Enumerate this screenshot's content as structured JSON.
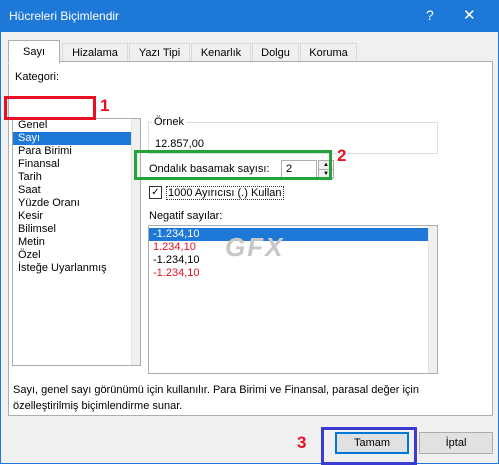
{
  "window": {
    "title": "Hücreleri Biçimlendir",
    "help_glyph": "?",
    "close_glyph": "✕"
  },
  "tabs": [
    {
      "label": "Sayı",
      "active": true
    },
    {
      "label": "Hizalama",
      "active": false
    },
    {
      "label": "Yazı Tipi",
      "active": false
    },
    {
      "label": "Kenarlık",
      "active": false
    },
    {
      "label": "Dolgu",
      "active": false
    },
    {
      "label": "Koruma",
      "active": false
    }
  ],
  "category": {
    "label": "Kategori:",
    "items": [
      {
        "label": "Genel",
        "selected": false
      },
      {
        "label": "Sayı",
        "selected": true
      },
      {
        "label": "Para Birimi",
        "selected": false
      },
      {
        "label": "Finansal",
        "selected": false
      },
      {
        "label": "Tarih",
        "selected": false
      },
      {
        "label": "Saat",
        "selected": false
      },
      {
        "label": "Yüzde Oranı",
        "selected": false
      },
      {
        "label": "Kesir",
        "selected": false
      },
      {
        "label": "Bilimsel",
        "selected": false
      },
      {
        "label": "Metin",
        "selected": false
      },
      {
        "label": "Özel",
        "selected": false
      },
      {
        "label": "İsteğe Uyarlanmış",
        "selected": false
      }
    ]
  },
  "sample": {
    "label": "Örnek",
    "value": "12.857,00"
  },
  "decimal": {
    "label": "Ondalık basamak sayısı:",
    "value": "2"
  },
  "separator": {
    "label": "1000 Ayırıcısı (.) Kullan",
    "checked": true,
    "check_glyph": "✓"
  },
  "negative": {
    "label": "Negatif sayılar:",
    "items": [
      {
        "label": "-1.234,10",
        "selected": true,
        "red": false
      },
      {
        "label": "1.234,10",
        "selected": false,
        "red": true
      },
      {
        "label": "-1.234,10",
        "selected": false,
        "red": false
      },
      {
        "label": "-1.234,10",
        "selected": false,
        "red": true
      }
    ]
  },
  "description": "Sayı, genel sayı görünümü için kullanılır. Para Birimi ve Finansal, parasal değer için özelleştirilmiş biçimlendirme sunar.",
  "buttons": {
    "ok": "Tamam",
    "cancel": "İptal"
  },
  "annotations": {
    "one": "1",
    "two": "2",
    "three": "3",
    "color_one": "#e81123",
    "color_two": "#22a33c",
    "color_three": "#3b3bd1"
  },
  "watermark": "GFX",
  "colors": {
    "accent": "#1e78d7",
    "negative_red": "#e81123"
  }
}
